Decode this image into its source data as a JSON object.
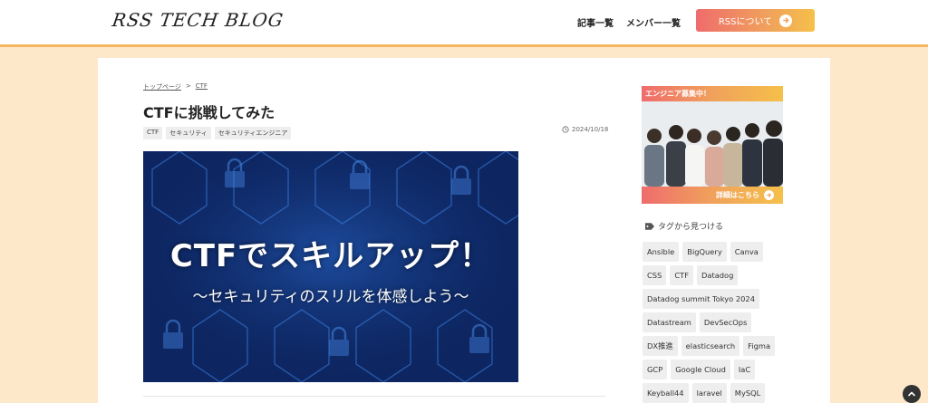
{
  "header": {
    "logo": "RSS TECH BLOG",
    "nav": [
      "記事一覧",
      "メンバー一覧"
    ],
    "rss_button": "RSSについて"
  },
  "breadcrumb": [
    "トップページ",
    ">",
    "CTF"
  ],
  "article": {
    "title": "CTFに挑戦してみた",
    "tags": [
      "CTF",
      "セキュリティ",
      "セキュリティエンジニア"
    ],
    "date": "2024/10/18",
    "hero_title": "CTFでスキルアップ！",
    "hero_subtitle": "〜セキュリティのスリルを体感しよう〜"
  },
  "sidebar": {
    "recruit_banner": {
      "heading": "エンジニア募集中！",
      "cta": "詳細はこちら"
    },
    "tag_section_title": "タグから見つける",
    "tags": [
      "Ansible",
      "BigQuery",
      "Canva",
      "CSS",
      "CTF",
      "Datadog",
      "Datadog summit Tokyo 2024",
      "Datastream",
      "DevSecOps",
      "DX推進",
      "elasticsearch",
      "Figma",
      "GCP",
      "Google Cloud",
      "IaC",
      "Keyball44",
      "laravel",
      "MySQL"
    ]
  },
  "colors": {
    "accent_start": "#ef6c6c",
    "accent_end": "#f5c04a",
    "page_bg": "#fde9c9",
    "header_border": "#f6b660",
    "hero_bg": "#0d2560"
  }
}
